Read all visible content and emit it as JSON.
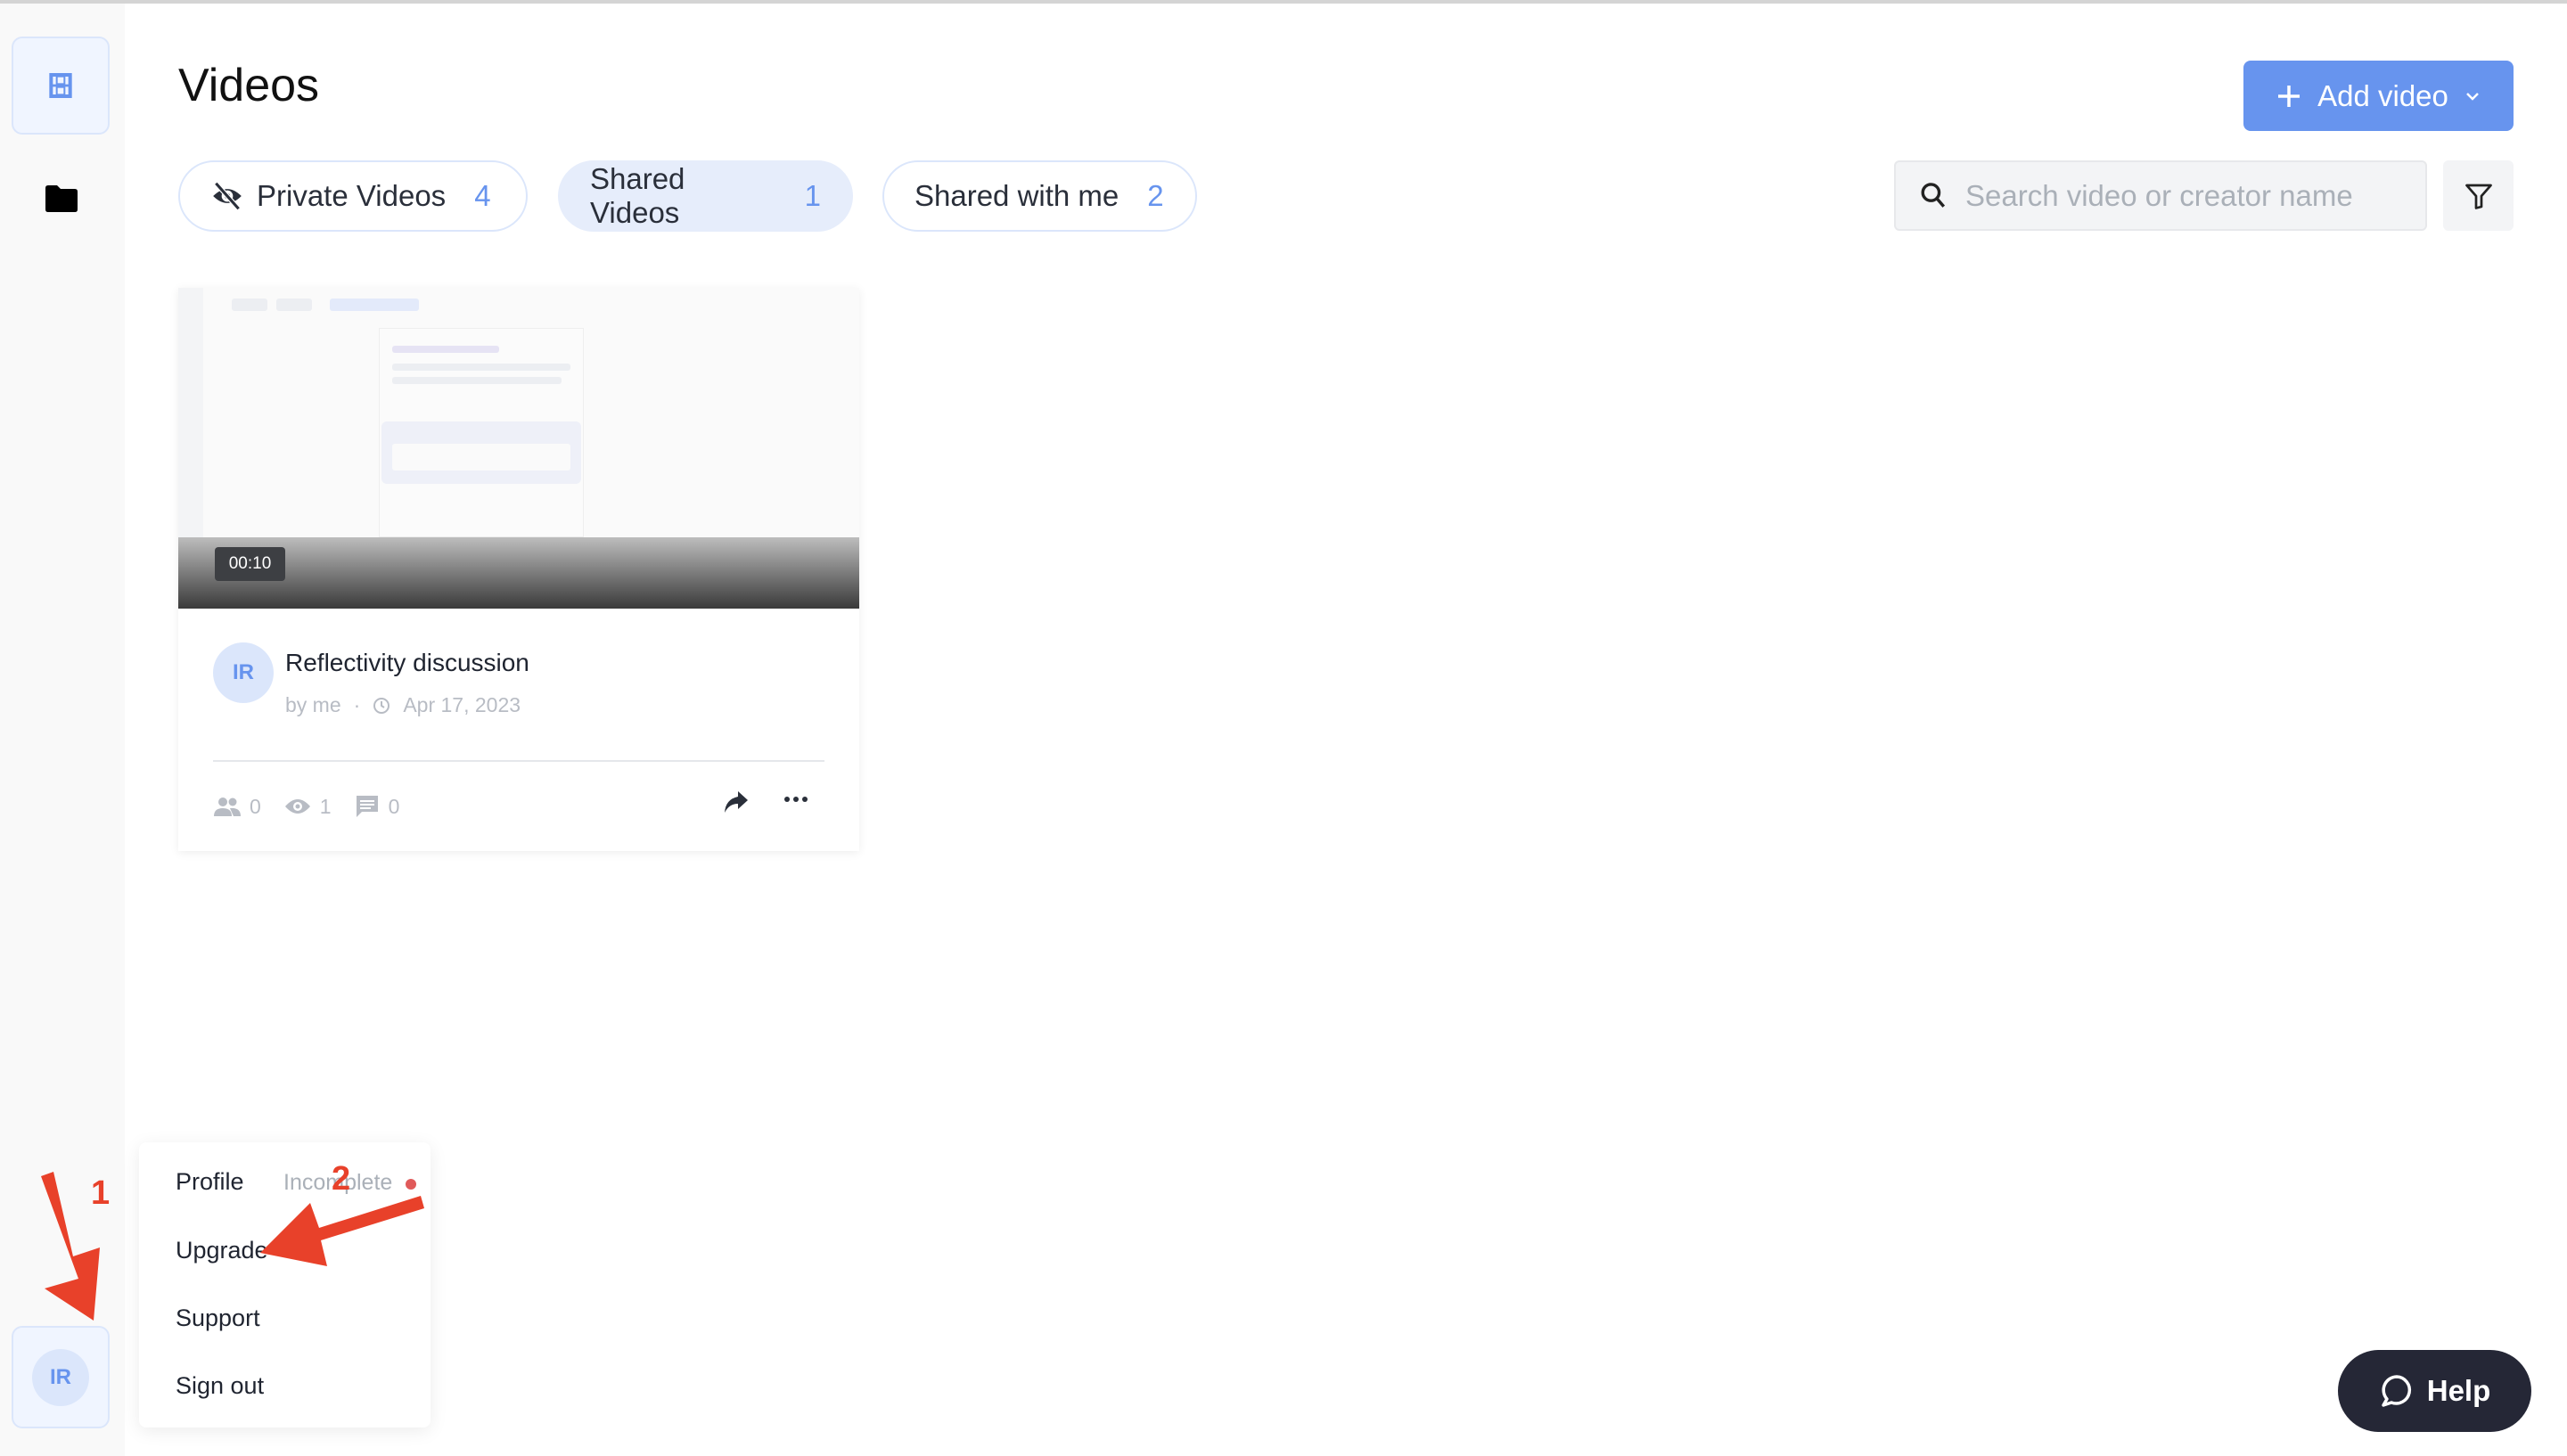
{
  "header": {
    "title": "Videos",
    "add_video_label": "Add video"
  },
  "tabs": [
    {
      "label": "Private Videos",
      "count": "4",
      "icon": "eye-off-icon"
    },
    {
      "label": "Shared Videos",
      "count": "1",
      "active": true
    },
    {
      "label": "Shared with me",
      "count": "2"
    }
  ],
  "search": {
    "placeholder": "Search video or creator name",
    "value": ""
  },
  "video": {
    "duration": "00:10",
    "avatar": "IR",
    "title": "Reflectivity discussion",
    "by": "by me",
    "sep": "·",
    "date": "Apr 17, 2023",
    "shares": "0",
    "views": "1",
    "comments": "0"
  },
  "user_menu": {
    "profile": "Profile",
    "profile_status": "Incomplete",
    "upgrade": "Upgrade",
    "support": "Support",
    "sign_out": "Sign out"
  },
  "user": {
    "initials": "IR"
  },
  "help": {
    "label": "Help"
  },
  "annotations": {
    "first": "1",
    "second": "2",
    "color": "#e8412a"
  },
  "colors": {
    "accent": "#6794ee",
    "help_bg": "#252736"
  }
}
